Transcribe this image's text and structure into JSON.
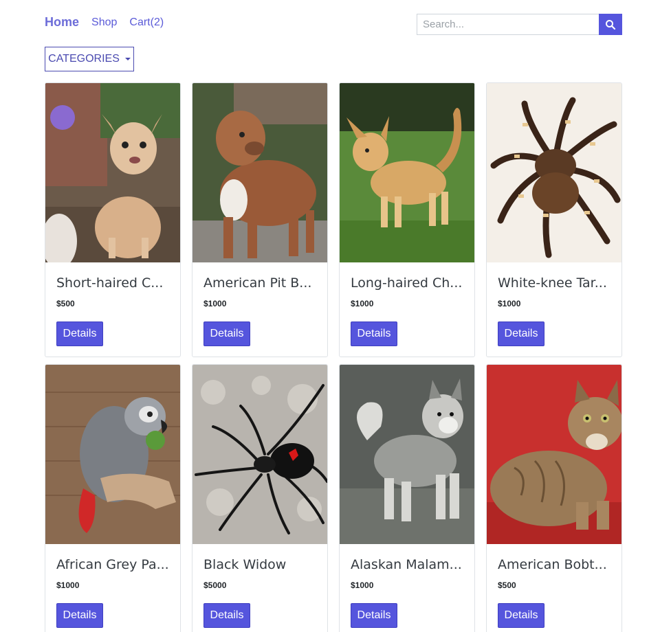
{
  "nav": {
    "home": "Home",
    "shop": "Shop",
    "cart": "Cart(2)"
  },
  "search": {
    "placeholder": "Search...",
    "value": ""
  },
  "categories": {
    "label": "CATEGORIES"
  },
  "products": [
    {
      "title": "Short-haired C...",
      "price": "$500",
      "button": "Details",
      "image": "chihuahua-photo"
    },
    {
      "title": "American Pit B...",
      "price": "$1000",
      "button": "Details",
      "image": "pitbull-photo"
    },
    {
      "title": "Long-haired Ch...",
      "price": "$1000",
      "button": "Details",
      "image": "long-haired-chihuahua-photo"
    },
    {
      "title": "White-knee Tar...",
      "price": "$1000",
      "button": "Details",
      "image": "tarantula-photo"
    },
    {
      "title": "African Grey Pa...",
      "price": "$1000",
      "button": "Details",
      "image": "grey-parrot-photo"
    },
    {
      "title": "Black Widow",
      "price": "$5000",
      "button": "Details",
      "image": "black-widow-photo"
    },
    {
      "title": "Alaskan Malam...",
      "price": "$1000",
      "button": "Details",
      "image": "malamute-photo"
    },
    {
      "title": "American Bobt...",
      "price": "$500",
      "button": "Details",
      "image": "bobtail-cat-photo"
    }
  ],
  "colors": {
    "accent": "#5555dd",
    "nav_link": "#5a5ad8"
  }
}
